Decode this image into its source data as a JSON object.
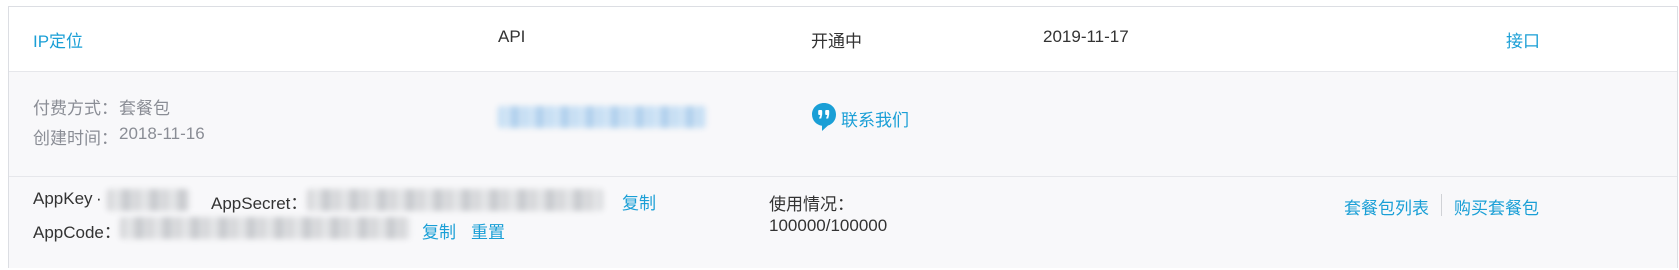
{
  "header": {
    "product_name": "IP定位",
    "type": "API",
    "status": "开通中",
    "date": "2019-11-17",
    "interface_link": "接口"
  },
  "details": {
    "payment_method_label": "付费方式：",
    "payment_method_value": "套餐包",
    "created_time_label": "创建时间：",
    "created_time_value": "2018-11-16",
    "contact_label": "联系我们"
  },
  "credentials": {
    "appkey_label": "AppKey",
    "appsecret_label": "AppSecret：",
    "appcode_label": "AppCode：",
    "copy_label": "复制",
    "reset_label": "重置",
    "usage_label": "使用情况：",
    "usage_value": "100000/100000",
    "package_list_label": "套餐包列表",
    "buy_package_label": "购买套餐包"
  },
  "colors": {
    "accent": "#1a9fd6",
    "muted_text": "#8a8d95",
    "row_bg": "#f8f8fa",
    "border": "#dcdee3"
  }
}
